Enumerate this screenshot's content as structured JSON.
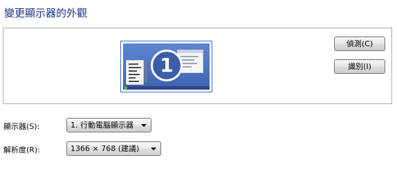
{
  "page_title": "變更顯示器的外觀",
  "preview": {
    "monitor_number": "1"
  },
  "buttons": {
    "detect": "偵測(C)",
    "identify": "識別(I)"
  },
  "display": {
    "label": "顯示器(S):",
    "selected": "1. 行動電腦顯示器"
  },
  "resolution": {
    "label": "解析度(R):",
    "selected": "1366 × 768 (建議)"
  },
  "icons": {
    "dropdown_arrow": "chevron-down-icon"
  },
  "colors": {
    "title": "#1e3287",
    "monitor_border": "#3b64c8",
    "monitor_screen": "#4d73c2"
  }
}
